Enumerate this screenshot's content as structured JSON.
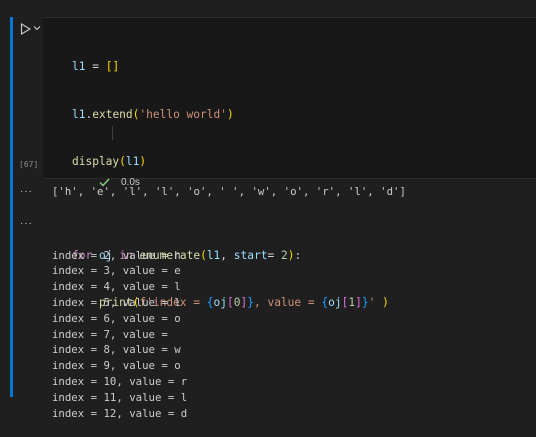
{
  "cell": {
    "execution_count": "[67]",
    "elapsed": "0.0s",
    "status_color": "#89d185",
    "accent_color": "#0078d4"
  },
  "code_lines": [
    "l1 = []",
    "l1.extend('hello world')",
    "display(l1)",
    "",
    "for oj in enumerate(l1, start= 2):",
    "    print(f'index = {oj[0]}, value = {oj[1]}' )"
  ],
  "outputs": {
    "ellipsis": "···",
    "display_output": "['h', 'e', 'l', 'l', 'o', ' ', 'w', 'o', 'r', 'l', 'd']",
    "print_lines": [
      "index = 2, value = h",
      "index = 3, value = e",
      "index = 4, value = l",
      "index = 5, value = l",
      "index = 6, value = o",
      "index = 7, value =  ",
      "index = 8, value = w",
      "index = 9, value = o",
      "index = 10, value = r",
      "index = 11, value = l",
      "index = 12, value = d"
    ]
  },
  "icons": {
    "run": "play-icon",
    "chevron": "chevron-down-icon",
    "status": "check-icon"
  }
}
